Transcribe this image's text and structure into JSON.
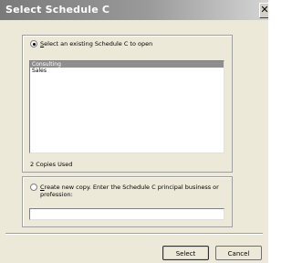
{
  "window": {
    "title": "Select Schedule C"
  },
  "existing": {
    "label_prefix": "",
    "label_accel": "S",
    "label_rest": "elect an existing Schedule C to open",
    "checked": true,
    "items": [
      {
        "label": "Consulting",
        "selected": true
      },
      {
        "label": "Sales",
        "selected": false
      }
    ],
    "copies_used": "2 Copies Used"
  },
  "create": {
    "label_accel": "C",
    "label_rest": "reate new copy.  Enter the Schedule C principal business or",
    "label_line2": "profession:",
    "checked": false,
    "input_value": ""
  },
  "buttons": {
    "select_label": "Select",
    "cancel_label": "Cancel"
  }
}
